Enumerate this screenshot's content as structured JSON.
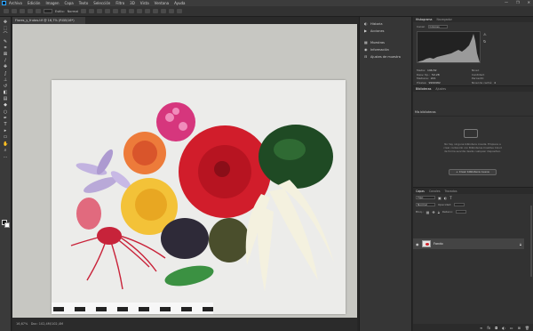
{
  "menu": {
    "items": [
      "Archivo",
      "Edición",
      "Imagen",
      "Capa",
      "Texto",
      "Selección",
      "Filtro",
      "3D",
      "Vista",
      "Ventana",
      "Ayuda"
    ],
    "window_controls": [
      "—",
      "❐",
      "✕"
    ]
  },
  "options_bar": {
    "labels": [
      "Estilo:",
      "Normal"
    ]
  },
  "document": {
    "tab_title": "Flores_y_frutas.tif @ 16,7% (RGB/16*)"
  },
  "status": {
    "zoom": "16,67%",
    "info": "Doc: 102,4M/102,4M"
  },
  "strip": {
    "items": [
      {
        "icon": "◐",
        "label": "Historia"
      },
      {
        "icon": "▶",
        "label": "Acciones"
      },
      {
        "icon": "▦",
        "label": "Muestras"
      },
      {
        "icon": "◉",
        "label": "Información"
      },
      {
        "icon": "⊟",
        "label": "Ajustes de muestra"
      }
    ]
  },
  "histogram": {
    "tabs": [
      "Histograma",
      "Navegador"
    ],
    "channel": "Colores",
    "stats": [
      {
        "k": "Media:",
        "v": "196,52"
      },
      {
        "k": "Nivel:",
        "v": ""
      },
      {
        "k": "Desv. tip.:",
        "v": "52,28"
      },
      {
        "k": "Cantidad:",
        "v": ""
      },
      {
        "k": "Mediana:",
        "v": "221"
      },
      {
        "k": "Percentil:",
        "v": ""
      },
      {
        "k": "Píxeles:",
        "v": "9999982"
      },
      {
        "k": "Nivel de caché:",
        "v": "4"
      }
    ]
  },
  "properties": {
    "tabs": [
      "Bibliotecas",
      "Ajustes"
    ],
    "sub_tab": "Mis bibliotecas",
    "message": "No hay ninguna biblioteca creada. Empiece a crear contenido con Bibliotecas Creative Cloud de forma sencilla desde cualquier dispositivo.",
    "button_label": "+ Crear biblioteca nueva"
  },
  "layers": {
    "tabs": [
      "Capas",
      "Canales",
      "Trazados"
    ],
    "filter": "Tipo",
    "blend_mode": "Normal",
    "opacity_label": "Opacidad:",
    "fill_label": "Relleno:",
    "lock_label": "Bloq.:",
    "layer_name": "Fondo"
  }
}
